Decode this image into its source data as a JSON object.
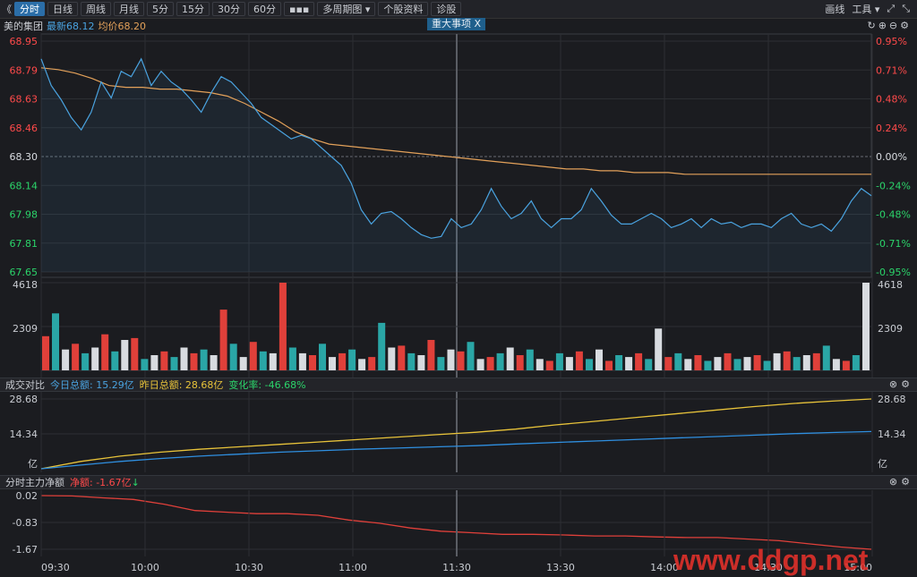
{
  "toolbar": {
    "back_glyph": "《",
    "buttons": [
      "分时",
      "日线",
      "周线",
      "月线",
      "5分",
      "15分",
      "30分",
      "60分",
      "▪▪▪",
      "多周期图 ▾",
      "个股资料",
      "诊股"
    ],
    "right": [
      "画线",
      "工具 ▾"
    ]
  },
  "info": {
    "name": "美的集团",
    "latest": "最新68.12",
    "avg": "均价68.20",
    "event_tag": "重大事项 X"
  },
  "price_axis": {
    "left": [
      "68.95",
      "68.79",
      "68.63",
      "68.46",
      "68.30",
      "68.14",
      "67.98",
      "67.81",
      "67.65"
    ],
    "right": [
      "0.95%",
      "0.71%",
      "0.48%",
      "0.24%",
      "0.00%",
      "-0.24%",
      "-0.48%",
      "-0.71%",
      "-0.95%"
    ]
  },
  "volume_axis": {
    "top": "4618",
    "mid": "2309"
  },
  "compare": {
    "title": "成交对比",
    "today": "今日总额: 15.29亿",
    "yesterday": "昨日总额: 28.68亿",
    "change": "变化率: -46.68%",
    "ticks": [
      "28.68",
      "14.34",
      "亿"
    ]
  },
  "flow": {
    "title": "分时主力净额",
    "net": "净额: -1.67亿",
    "ticks": [
      "0.02",
      "-0.83",
      "-1.67"
    ]
  },
  "time_axis": [
    "09:30",
    "10:00",
    "10:30",
    "11:00",
    "11:30",
    "13:30",
    "14:00",
    "14:30",
    "15:00"
  ],
  "watermark": "www.ddgp.net",
  "chart_data": {
    "type": "line",
    "title": "美的集团",
    "series": [
      {
        "name": "最新",
        "color": "#4aa3e0",
        "values": [
          68.85,
          68.7,
          68.62,
          68.52,
          68.45,
          68.55,
          68.72,
          68.63,
          68.78,
          68.75,
          68.85,
          68.7,
          68.78,
          68.72,
          68.68,
          68.62,
          68.55,
          68.66,
          68.75,
          68.72,
          68.66,
          68.6,
          68.52,
          68.48,
          68.44,
          68.4,
          68.42,
          68.4,
          68.35,
          68.3,
          68.25,
          68.15,
          68.0,
          67.92,
          67.98,
          67.99,
          67.95,
          67.9,
          67.86,
          67.84,
          67.85,
          67.95,
          67.9,
          67.92,
          68.0,
          68.12,
          68.02,
          67.95,
          67.98,
          68.05,
          67.95,
          67.9,
          67.95,
          67.95,
          68.0,
          68.12,
          68.05,
          67.97,
          67.92,
          67.92,
          67.95,
          67.98,
          67.95,
          67.9,
          67.92,
          67.95,
          67.9,
          67.95,
          67.92,
          67.93,
          67.9,
          67.92,
          67.92,
          67.9,
          67.95,
          67.98,
          67.92,
          67.9,
          67.92,
          67.88,
          67.95,
          68.05,
          68.12,
          68.08
        ]
      },
      {
        "name": "均价",
        "color": "#e3a15a",
        "values": [
          68.8,
          68.79,
          68.77,
          68.74,
          68.7,
          68.69,
          68.69,
          68.68,
          68.68,
          68.67,
          68.66,
          68.64,
          68.6,
          68.55,
          68.5,
          68.44,
          68.4,
          68.37,
          68.36,
          68.35,
          68.34,
          68.33,
          68.32,
          68.31,
          68.3,
          68.29,
          68.28,
          68.27,
          68.26,
          68.25,
          68.24,
          68.23,
          68.23,
          68.22,
          68.22,
          68.21,
          68.21,
          68.21,
          68.2,
          68.2,
          68.2,
          68.2,
          68.2,
          68.2,
          68.2,
          68.2,
          68.2,
          68.2,
          68.2,
          68.2
        ]
      }
    ],
    "volume": [
      1800,
      3000,
      1100,
      1400,
      900,
      1200,
      1900,
      1000,
      1600,
      1700,
      600,
      800,
      1000,
      700,
      1200,
      900,
      1100,
      800,
      3200,
      1400,
      700,
      1500,
      1000,
      900,
      4618,
      1200,
      900,
      800,
      1400,
      700,
      900,
      1100,
      600,
      700,
      2500,
      1200,
      1300,
      900,
      800,
      1600,
      700,
      1100,
      1000,
      1500,
      600,
      700,
      900,
      1200,
      800,
      1100,
      600,
      500,
      900,
      700,
      1000,
      600,
      1100,
      500,
      800,
      700,
      900,
      600,
      2200,
      700,
      900,
      600,
      800,
      500,
      700,
      900,
      600,
      700,
      800,
      500,
      900,
      1000,
      700,
      800,
      900,
      1300,
      600,
      500,
      800,
      4618
    ],
    "turnover_today": [
      0,
      1.5,
      3.0,
      4.2,
      5.2,
      6.0,
      6.8,
      7.4,
      8.0,
      8.5,
      9.0,
      9.5,
      10.2,
      10.8,
      11.4,
      12.0,
      12.6,
      13.2,
      13.8,
      14.4,
      14.9,
      15.29
    ],
    "turnover_yesterday": [
      0,
      3.0,
      5.2,
      6.8,
      8.0,
      9.0,
      10.0,
      11.0,
      12.0,
      13.0,
      14.0,
      15.0,
      16.3,
      18.0,
      19.5,
      21.0,
      22.5,
      24.0,
      25.5,
      26.8,
      27.8,
      28.68
    ],
    "net_flow": [
      0.02,
      0.01,
      -0.05,
      -0.1,
      -0.25,
      -0.45,
      -0.5,
      -0.55,
      -0.55,
      -0.6,
      -0.75,
      -0.85,
      -1.0,
      -1.1,
      -1.15,
      -1.2,
      -1.2,
      -1.22,
      -1.25,
      -1.25,
      -1.28,
      -1.3,
      -1.3,
      -1.35,
      -1.4,
      -1.5,
      -1.6,
      -1.67
    ]
  }
}
